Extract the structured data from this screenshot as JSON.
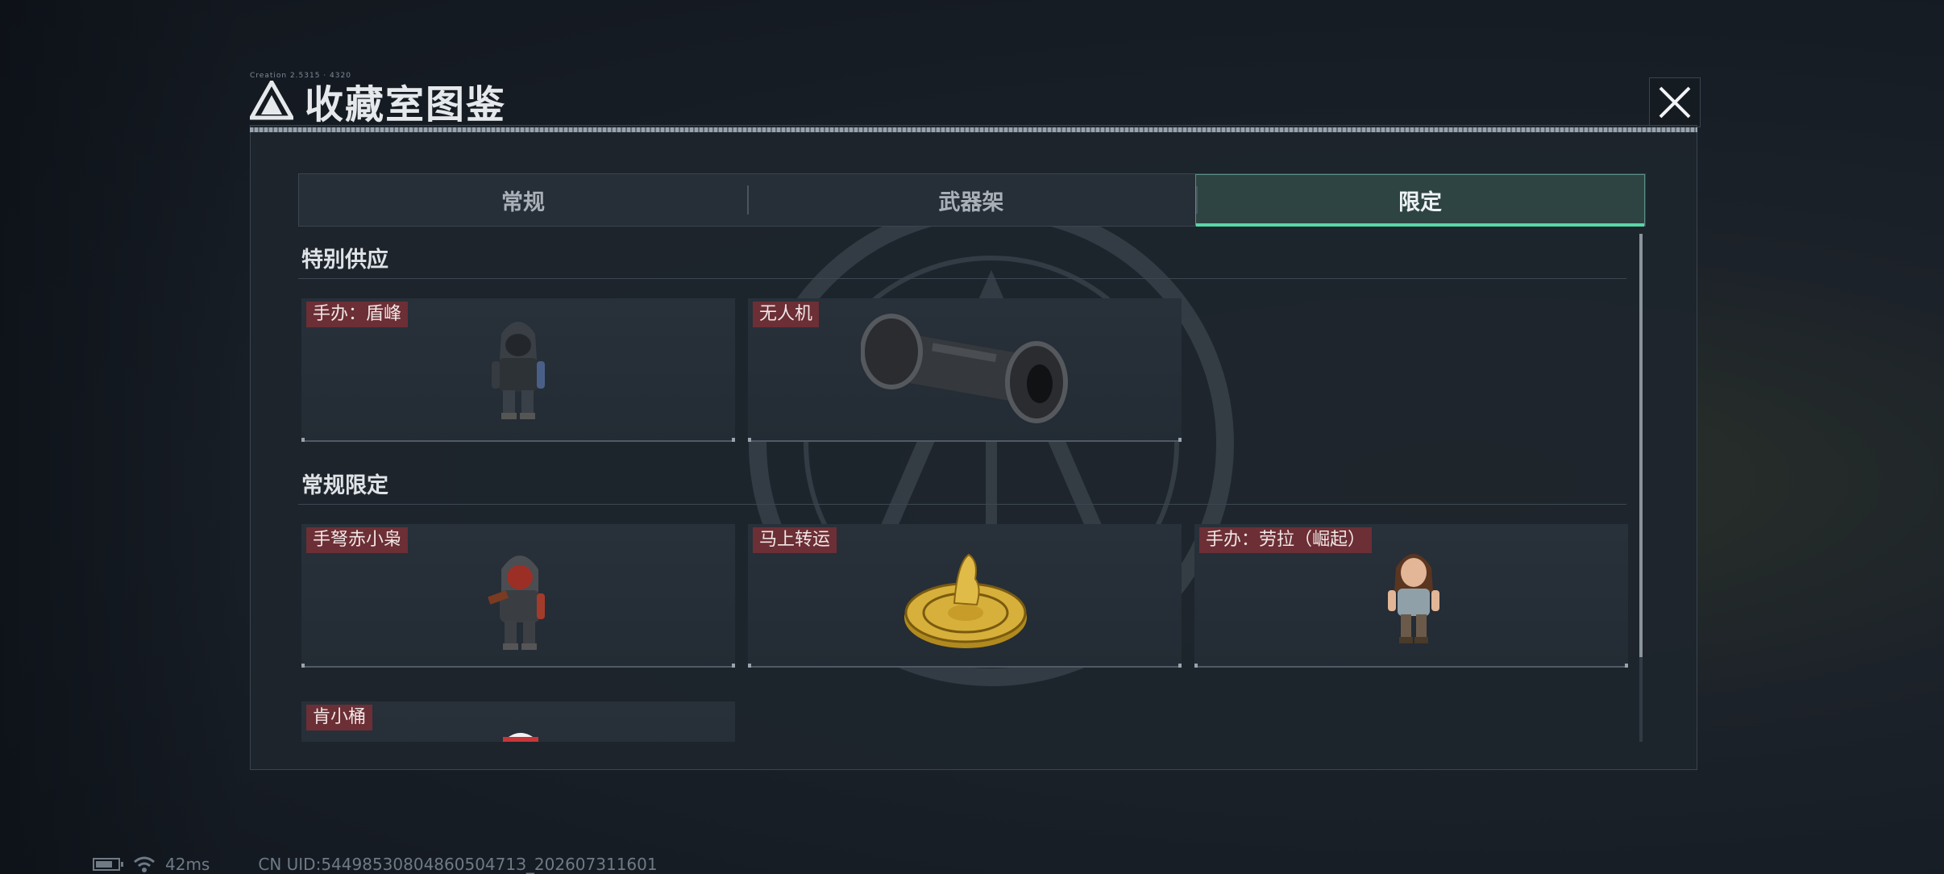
{
  "window": {
    "title": "收藏室图鉴",
    "title_small": "Creation 2.5315 · 4320"
  },
  "tabs": [
    {
      "label": "常规",
      "active": false
    },
    {
      "label": "武器架",
      "active": false
    },
    {
      "label": "限定",
      "active": true
    }
  ],
  "sections": [
    {
      "title": "特别供应",
      "items": [
        {
          "label": "手办：盾峰",
          "icon": "figure-hooded-soldier-icon"
        },
        {
          "label": "无人机",
          "icon": "drone-cylinder-icon"
        }
      ]
    },
    {
      "title": "常规限定",
      "items": [
        {
          "label": "手弩赤小枭",
          "icon": "figure-red-hood-icon"
        },
        {
          "label": "马上转运",
          "icon": "golden-horse-wheel-icon"
        },
        {
          "label": "手办：劳拉（崛起）",
          "icon": "figure-lara-icon"
        },
        {
          "label": "肯小桶",
          "icon": "white-item-icon"
        }
      ]
    }
  ],
  "status": {
    "ping": "42ms",
    "uid": "CN UID:5449853080486050471З_202607311601"
  },
  "colors": {
    "accent": "#58d6a8",
    "label_bg": "#6b2f35",
    "active_tab_bg": "#2e4443"
  }
}
